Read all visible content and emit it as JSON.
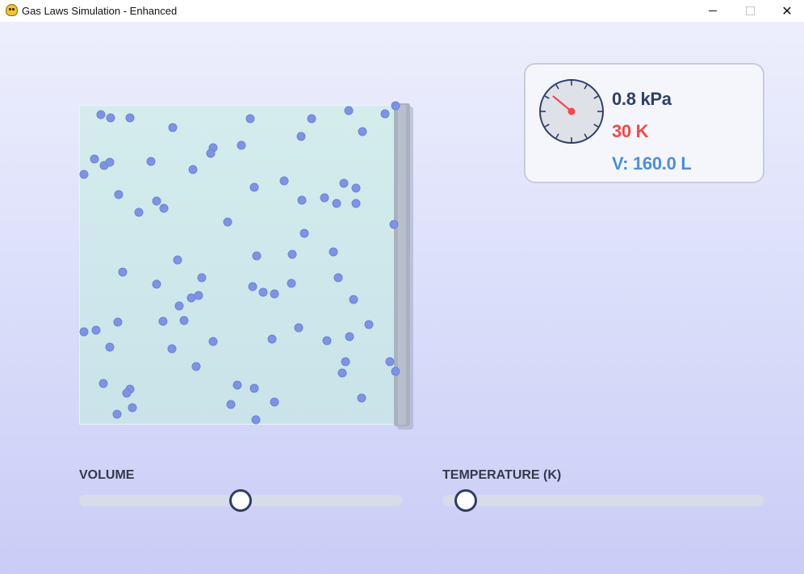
{
  "window": {
    "title": "Gas Laws Simulation - Enhanced",
    "icon": "pygame-snake-icon",
    "controls": {
      "minimize": "minimize-icon",
      "maximize": "maximize-icon",
      "close": "✕"
    }
  },
  "colors": {
    "pressure": "#2f3e66",
    "temperature": "#ee4a4a",
    "volume": "#4d8fd6",
    "molecule": "#7e93e2",
    "gauge_needle": "#ee4a4a"
  },
  "readouts": {
    "pressure": "0.8 kPa",
    "temperature": "30 K",
    "volume": "V: 160.0 L"
  },
  "gauge": {
    "needle_fraction": 0.125
  },
  "sliders": {
    "volume": {
      "label": "VOLUME",
      "fraction": 0.5
    },
    "temperature": {
      "label": "TEMPERATURE (K)",
      "fraction": 0.07
    }
  },
  "molecules": {
    "count": 74
  }
}
